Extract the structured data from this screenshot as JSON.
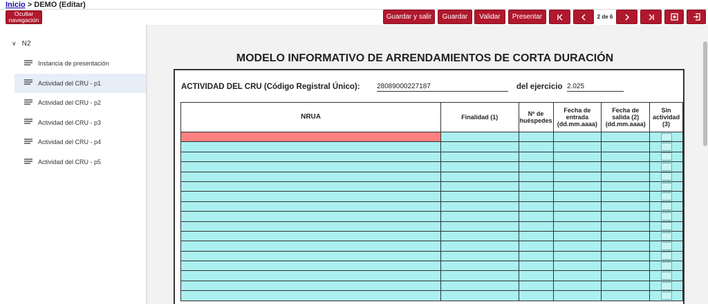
{
  "breadcrumb": {
    "home": "Inicio",
    "current": " > DEMO (Editar)"
  },
  "toolbar": {
    "hide_nav": "Ocultar navegación",
    "save_exit": "Guardar y salir",
    "save": "Guardar",
    "validate": "Validar",
    "present": "Presentar",
    "page_indicator": "2 de 6",
    "accent_color": "#b0182d"
  },
  "sidebar": {
    "root": "N2",
    "items": [
      {
        "label": "Instancia de presentación"
      },
      {
        "label": "Actividad del CRU - p1"
      },
      {
        "label": "Actividad del CRU - p2"
      },
      {
        "label": "Actividad del CRU - p3"
      },
      {
        "label": "Actividad del CRU - p4"
      },
      {
        "label": "Actividad del CRU - p5"
      }
    ],
    "active_index": 1
  },
  "form": {
    "title": "MODELO INFORMATIVO DE ARRENDAMIENTOS DE CORTA DURACIÓN",
    "cru_label": "ACTIVIDAD DEL CRU (Código Registral Único):",
    "cru_value": "28089000227187",
    "ejercicio_label": "del ejercicio",
    "ejercicio_value": "2.025",
    "columns": [
      "NRUA",
      "Finalidad (1)",
      "Nº de huéspedes",
      "Fecha de entrada (dd.mm.aaaa)",
      "Fecha de salida (2) (dd.mm.aaaa)",
      "Sin actividad (3)"
    ],
    "field_color": "#aaf0f0",
    "error_color": "#ff8080"
  }
}
